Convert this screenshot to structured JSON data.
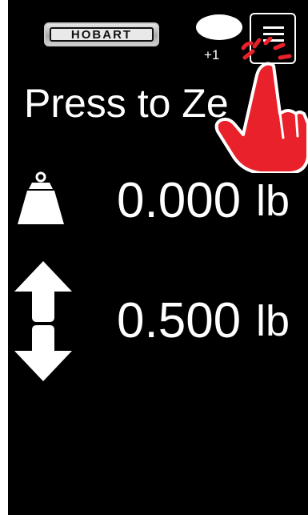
{
  "header": {
    "brand_logo_text": "HOBART",
    "counter_label": "+1",
    "icons": {
      "menu": "hamburger-menu-icon",
      "indicator": "white-oval-indicator"
    }
  },
  "zero_prompt": {
    "label": "Press to Ze"
  },
  "readings": {
    "gross": {
      "icon": "weight-icon",
      "value": "0.000",
      "unit": "lb"
    },
    "tare": {
      "icon": "up-down-arrows-icon",
      "value": "0.500",
      "unit": "lb"
    }
  },
  "overlay": {
    "icon": "tap-hand-pointer-icon",
    "color": "#e8212a"
  },
  "colors": {
    "background": "#000000",
    "text": "#ffffff",
    "highlight": "#e8212a"
  }
}
